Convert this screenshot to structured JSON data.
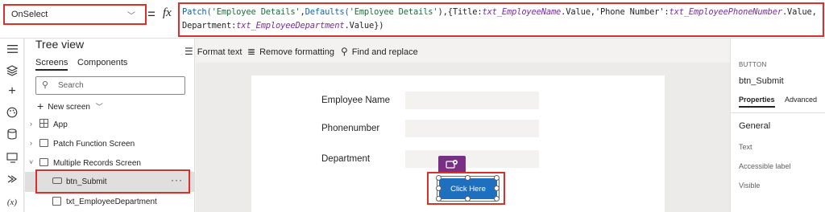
{
  "formula_bar": {
    "property": "OnSelect",
    "equals": "=",
    "fx": "fx",
    "line1": [
      {
        "t": "Patch(",
        "k": "fn"
      },
      {
        "t": "'Employee Details'",
        "k": "str"
      },
      {
        "t": ",",
        "k": "plain"
      },
      {
        "t": "Defaults(",
        "k": "fn"
      },
      {
        "t": "'Employee Details'",
        "k": "str"
      },
      {
        "t": "),{Title:",
        "k": "plain"
      },
      {
        "t": "txt_EmployeeName",
        "k": "ctrl"
      },
      {
        "t": ".Value,'Phone Number':",
        "k": "plain"
      },
      {
        "t": "txt_EmployeePhoneNumber",
        "k": "ctrl"
      },
      {
        "t": ".Value,",
        "k": "plain"
      }
    ],
    "line2": [
      {
        "t": "Department:",
        "k": "plain"
      },
      {
        "t": "txt_EmployeeDepartment",
        "k": "ctrl"
      },
      {
        "t": ".Value})",
        "k": "plain"
      }
    ]
  },
  "rail": {
    "icons": [
      "hamburger-icon",
      "layers-icon",
      "plus-icon",
      "palette-icon",
      "database-icon",
      "media-icon",
      "advanced-tools-icon",
      "variables-icon"
    ],
    "variables_label": "(x)"
  },
  "tree": {
    "title": "Tree view",
    "tabs": [
      "Screens",
      "Components"
    ],
    "search_placeholder": "Search",
    "new_screen": "New screen",
    "nodes": [
      {
        "label": "App"
      },
      {
        "label": "Patch Function Screen"
      },
      {
        "label": "Multiple Records Screen"
      },
      {
        "label": "btn_Submit"
      },
      {
        "label": "txt_EmployeeDepartment"
      }
    ],
    "more": "···"
  },
  "toolbar": {
    "format_text": "Format text",
    "remove_formatting": "Remove formatting",
    "find_replace": "Find and replace"
  },
  "canvas": {
    "labels": [
      "Employee Name",
      "Phonenumber",
      "Department"
    ],
    "button_text": "Click Here"
  },
  "props": {
    "type": "BUTTON",
    "name": "btn_Submit",
    "tabs": [
      "Properties",
      "Advanced"
    ],
    "section": "General",
    "rows": [
      "Text",
      "Accessible label",
      "Visible"
    ]
  },
  "colors": {
    "accent_red": "#d9302c",
    "button_blue": "#1f6fbf",
    "ai_purple": "#7a2f86"
  }
}
